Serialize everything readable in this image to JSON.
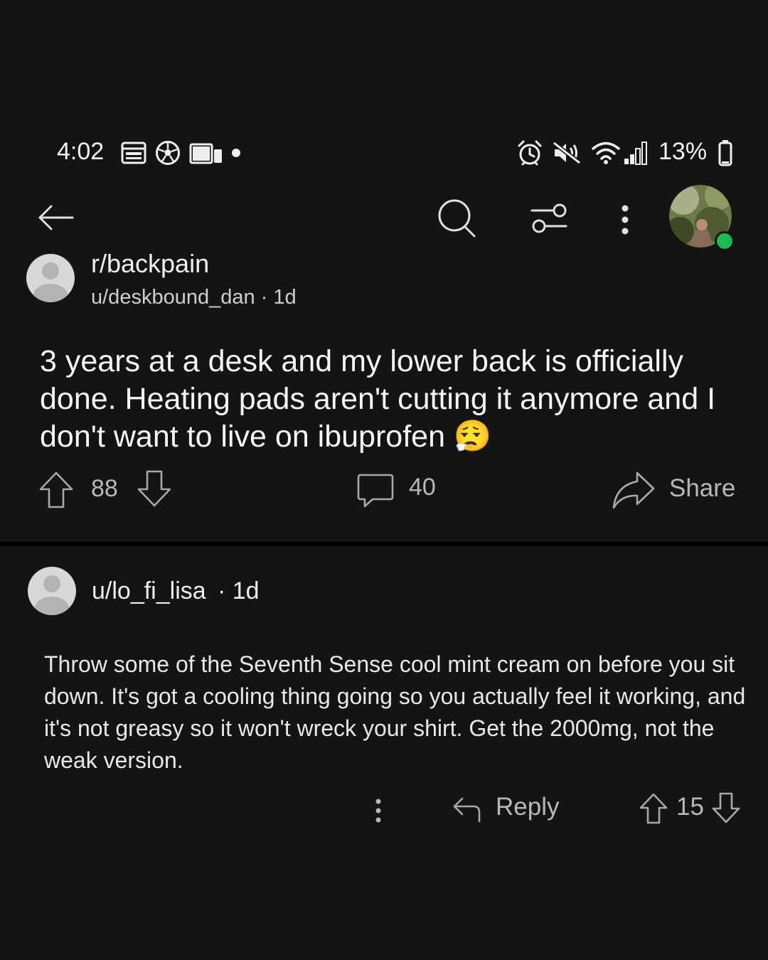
{
  "status_bar": {
    "time": "4:02",
    "battery": "13%",
    "left_icons": [
      "browser-icon",
      "soccer-ball-icon",
      "devices-icon",
      "dot-icon"
    ],
    "right_icons": [
      "alarm-icon",
      "mute-icon",
      "wifi-icon",
      "signal-icon",
      "battery-icon"
    ]
  },
  "toolbar": {
    "icons": [
      "back-arrow-icon",
      "search-icon",
      "filter-icon",
      "more-icon",
      "user-avatar"
    ],
    "online_color": "#1db954"
  },
  "post": {
    "subreddit": "r/backpain",
    "meta": "u/deskbound_dan · 1d",
    "title": "3 years at a desk and my lower back is officially done. Heating pads aren't cutting it anymore and I don't want to live on ibuprofen 😮‍💨",
    "votes": "88",
    "comments": "40",
    "share_label": "Share"
  },
  "comment": {
    "author": "u/lo_fi_lisa",
    "time": "· 1d",
    "body": "Throw some of the Seventh Sense cool mint cream on before you sit down. It's got a cooling thing going so you actually feel it working, and it's not greasy so it won't wreck your shirt. Get the 2000mg, not the weak version.",
    "reply_label": "Reply",
    "votes": "15"
  },
  "colors": {
    "background": "#141414",
    "text_primary": "#f5f5f5",
    "text_secondary": "#b8b8b8",
    "divider": "#000000"
  }
}
